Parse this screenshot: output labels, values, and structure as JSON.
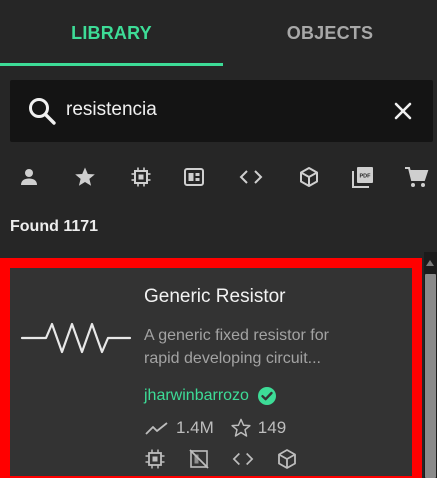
{
  "tabs": [
    {
      "label": "LIBRARY",
      "active": true
    },
    {
      "label": "OBJECTS",
      "active": false
    }
  ],
  "search": {
    "value": "resistencia",
    "icon": "search-icon",
    "clear_icon": "close-icon"
  },
  "filters": [
    {
      "icon": "person-icon"
    },
    {
      "icon": "star-icon"
    },
    {
      "icon": "chip-icon"
    },
    {
      "icon": "board-icon"
    },
    {
      "icon": "code-icon"
    },
    {
      "icon": "cube-icon"
    },
    {
      "icon": "pdf-icon"
    },
    {
      "icon": "cart-icon"
    }
  ],
  "results": {
    "found_label": "Found 1171",
    "items": [
      {
        "title": "Generic Resistor",
        "description_line1": "A generic fixed resistor for",
        "description_line2": "rapid developing circuit...",
        "author": "jharwinbarrozo",
        "verified": true,
        "views": "1.4M",
        "stars": "149",
        "tags": [
          "chip-icon",
          "no-pcb-icon",
          "code-icon",
          "cube-icon"
        ]
      }
    ]
  },
  "colors": {
    "accent": "#3ddc97",
    "background": "#262626",
    "search_bg": "#141414",
    "card_bg": "#333333",
    "highlight_border": "#ff0000"
  }
}
